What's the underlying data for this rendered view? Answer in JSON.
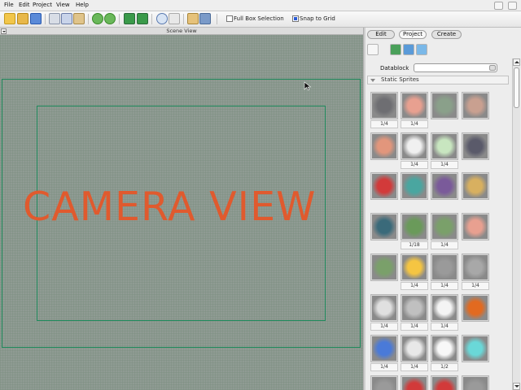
{
  "menu": [
    "File",
    "Edit",
    "Project",
    "View",
    "Help"
  ],
  "toolbar": {
    "full_box_selection_label": "Full Box Selection",
    "full_box_selection_checked": false,
    "snap_to_grid_label": "Snap to Grid",
    "snap_to_grid_checked": true
  },
  "scene": {
    "header": "Scene View",
    "camera_label": "CAMERA VIEW"
  },
  "panel": {
    "tabs": [
      "Edit",
      "Project",
      "Create"
    ],
    "active_tab": "Project",
    "datablock_label": "Datablock",
    "datablock_value": "",
    "section_title": "Static Sprites",
    "sprites": [
      {
        "icon": "rock-icon",
        "color": "#6e6e72",
        "frames": "1/4"
      },
      {
        "icon": "pink-cloud-icon",
        "color": "#e8a090",
        "frames": "1/4"
      },
      {
        "icon": "grass-hills-icon",
        "color": "#8aa08a",
        "frames": ""
      },
      {
        "icon": "pink-hills-icon",
        "color": "#c9a090",
        "frames": ""
      },
      {
        "icon": "sunset-gradient-icon",
        "color": "#e2967c",
        "frames": ""
      },
      {
        "icon": "swirl-icon",
        "color": "#f0f0f0",
        "frames": "1/4"
      },
      {
        "icon": "glow-orb-icon",
        "color": "#c8e6c0",
        "frames": "1/4"
      },
      {
        "icon": "dragon-icon",
        "color": "#5a5a6a",
        "frames": ""
      },
      {
        "icon": "health-orb-icon",
        "color": "#d23a3a",
        "frames": ""
      },
      {
        "icon": "crown-icon",
        "color": "#4aa6a0",
        "frames": ""
      },
      {
        "icon": "ring-purple-icon",
        "color": "#7a5a9a",
        "frames": ""
      },
      {
        "icon": "shield-emblem-icon",
        "color": "#d8b060",
        "frames": ""
      },
      {
        "icon": "whale-icon",
        "color": "#3a6a7a",
        "frames": ""
      },
      {
        "icon": "green-frame-icon",
        "color": "#6a9a5a",
        "frames": "1/18"
      },
      {
        "icon": "tree-icon",
        "color": "#7aa06a",
        "frames": "1/4"
      },
      {
        "icon": "pink-cloud-icon",
        "color": "#e8a090",
        "frames": ""
      },
      {
        "icon": "tree-icon",
        "color": "#7aa06a",
        "frames": ""
      },
      {
        "icon": "spark-icon",
        "color": "#f5c542",
        "frames": "1/4"
      },
      {
        "icon": "dust-icon",
        "color": "#9a9a9a",
        "frames": "1/4"
      },
      {
        "icon": "dot-icon",
        "color": "#a8a8a8",
        "frames": "1/4"
      },
      {
        "icon": "soft-glow-icon",
        "color": "#e0e0e0",
        "frames": "1/4"
      },
      {
        "icon": "smoke-icon",
        "color": "#c0c0c0",
        "frames": "1/4"
      },
      {
        "icon": "white-ring-icon",
        "color": "#f4f4f4",
        "frames": "1/4"
      },
      {
        "icon": "fire-ring-icon",
        "color": "#e26a20",
        "frames": ""
      },
      {
        "icon": "lightning-icon",
        "color": "#4a7ad8",
        "frames": "1/4"
      },
      {
        "icon": "white-smoke-icon",
        "color": "#e8e8e8",
        "frames": "1/4"
      },
      {
        "icon": "beam-icon",
        "color": "#f8f8f8",
        "frames": "1/2"
      },
      {
        "icon": "cyan-glow-icon",
        "color": "#6ad8d8",
        "frames": ""
      },
      {
        "icon": "grey-tile-icon",
        "color": "#9a9a9a",
        "frames": ""
      },
      {
        "icon": "eye-badge-icon",
        "color": "#d23a3a",
        "frames": ""
      },
      {
        "icon": "red-arrow-icon",
        "color": "#d23a3a",
        "frames": ""
      },
      {
        "icon": "grey-tile-icon",
        "color": "#9a9a9a",
        "frames": ""
      }
    ]
  }
}
